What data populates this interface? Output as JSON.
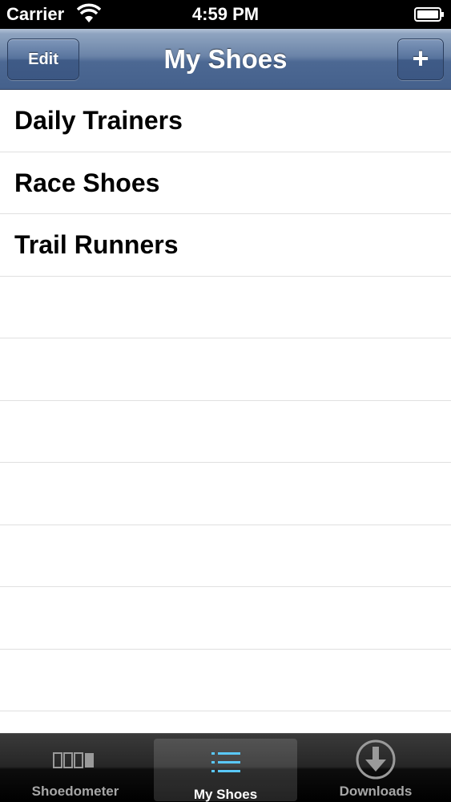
{
  "status_bar": {
    "carrier": "Carrier",
    "time": "4:59 PM"
  },
  "nav_bar": {
    "edit_label": "Edit",
    "title": "My Shoes",
    "add_label": "+"
  },
  "shoes": [
    {
      "name": "Daily Trainers"
    },
    {
      "name": "Race Shoes"
    },
    {
      "name": "Trail Runners"
    }
  ],
  "tab_bar": {
    "tabs": [
      {
        "label": "Shoedometer",
        "icon": "odometer-icon",
        "selected": false
      },
      {
        "label": "My Shoes",
        "icon": "list-icon",
        "selected": true
      },
      {
        "label": "Downloads",
        "icon": "download-icon",
        "selected": false
      }
    ]
  },
  "colors": {
    "nav_bar": "#4c6893",
    "selected_tab_icon": "#5ac8fa"
  }
}
